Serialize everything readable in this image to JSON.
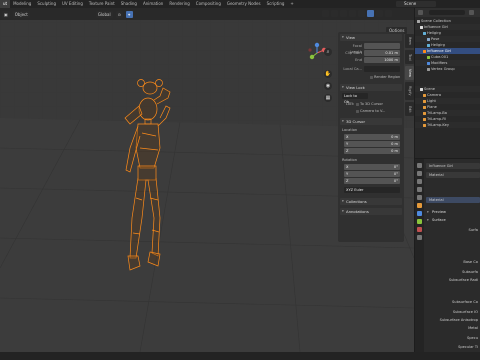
{
  "menubar": {
    "tabs": [
      "ut",
      "Modeling",
      "Sculpting",
      "UV Editing",
      "Texture Paint",
      "Shading",
      "Animation",
      "Rendering",
      "Compositing",
      "Geometry Nodes",
      "Scripting",
      "+"
    ],
    "active_index": 0,
    "scene_label": "Scene"
  },
  "viewport": {
    "mode_label": "Object",
    "transform_label": "Global",
    "options_label": "Options"
  },
  "npanel": {
    "view_section": "View",
    "focal_length_label": "Focal Length",
    "focal_length_value": "",
    "clip_start_label": "Clip Start",
    "clip_start_value": "0.01 m",
    "clip_end_label": "End",
    "clip_end_value": "1000 m",
    "local_camera_label": "Local Ca...",
    "render_region_label": "Render Region",
    "view_lock_section": "View Lock",
    "lock_to_object_label": "Lock to Ob...",
    "lock_label": "Lock",
    "to_3d_cursor_label": "To 3D Cursor",
    "camera_to_view_label": "Camera to V...",
    "cursor_section": "3D Cursor",
    "location_label": "Location",
    "x_label": "X",
    "y_label": "Y",
    "z_label": "Z",
    "loc_x": "0 m",
    "loc_y": "0 m",
    "loc_z": "0 m",
    "rotation_label": "Rotation",
    "rot_x": "0°",
    "rot_y": "0°",
    "rot_z": "0°",
    "rotation_mode": "XYZ Euler",
    "collections_section": "Collections",
    "annotations_section": "Annotations"
  },
  "panel_tabs": [
    "Item",
    "Tool",
    "View",
    "Rigify",
    "Edit"
  ],
  "panel_tabs_active": 2,
  "outliner": {
    "rows": [
      "Scene Collection",
      "Influence Girl",
      "Hellgirg",
      "Pose",
      "Hellgirg",
      "Influence Girl",
      "Cube.001",
      "Modifiers",
      "Vertex Group",
      "Scene",
      "Camera",
      "Light",
      "Plane",
      "TriLamp-Ba",
      "TriLamp-Fil",
      "TriLamp-Key"
    ],
    "selected_index": 5
  },
  "properties": {
    "object_label": "Influence Girl",
    "material_label": "Material",
    "material_slot": "Material",
    "preview_label": "Preview",
    "surface_label": "Surface",
    "surface_item": "Surfa",
    "rows": [
      "Base Co",
      "Subsurfa",
      "Subsurface Radi",
      "Subsurface Co",
      "Subsurface IO",
      "Subsurface Anisotrop",
      "Metal",
      "Specu",
      "Specular Ti"
    ]
  },
  "colors": {
    "selection_orange": "#ff8c1a",
    "selection_blue": "#4772b3",
    "viewport_bg": "#3a3a3a"
  }
}
